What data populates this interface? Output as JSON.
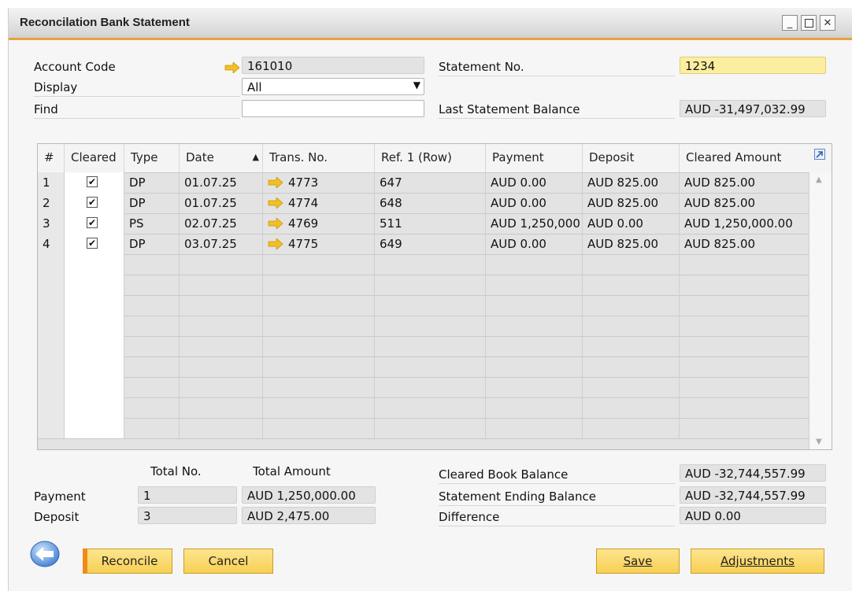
{
  "window": {
    "title": "Reconcilation Bank Statement"
  },
  "header": {
    "account_code_label": "Account Code",
    "account_code_value": "161010",
    "display_label": "Display",
    "display_value": "All",
    "find_label": "Find",
    "find_value": "",
    "statement_no_label": "Statement No.",
    "statement_no_value": "1234",
    "last_balance_label": "Last Statement Balance",
    "last_balance_value": "AUD -31,497,032.99"
  },
  "grid": {
    "columns": [
      "#",
      "Cleared",
      "Type",
      "Date",
      "Trans. No.",
      "Ref. 1 (Row)",
      "Payment",
      "Deposit",
      "Cleared Amount"
    ],
    "rows": [
      {
        "num": "1",
        "cleared": true,
        "type": "DP",
        "date": "01.07.25",
        "trans_no": "4773",
        "ref": "647",
        "payment": "AUD 0.00",
        "deposit": "AUD 825.00",
        "cleared_amount": "AUD 825.00"
      },
      {
        "num": "2",
        "cleared": true,
        "type": "DP",
        "date": "01.07.25",
        "trans_no": "4774",
        "ref": "648",
        "payment": "AUD 0.00",
        "deposit": "AUD 825.00",
        "cleared_amount": "AUD 825.00"
      },
      {
        "num": "3",
        "cleared": true,
        "type": "PS",
        "date": "02.07.25",
        "trans_no": "4769",
        "ref": "511",
        "payment": "AUD 1,250,000",
        "deposit": "AUD 0.00",
        "cleared_amount": "AUD 1,250,000.00"
      },
      {
        "num": "4",
        "cleared": true,
        "type": "DP",
        "date": "03.07.25",
        "trans_no": "4775",
        "ref": "649",
        "payment": "AUD 0.00",
        "deposit": "AUD 825.00",
        "cleared_amount": "AUD 825.00"
      }
    ]
  },
  "totals": {
    "total_no_label": "Total No.",
    "total_amount_label": "Total Amount",
    "payment_label": "Payment",
    "payment_count": "1",
    "payment_amount": "AUD 1,250,000.00",
    "deposit_label": "Deposit",
    "deposit_count": "3",
    "deposit_amount": "AUD 2,475.00",
    "cleared_book_label": "Cleared Book Balance",
    "cleared_book_value": "AUD -32,744,557.99",
    "ending_balance_label": "Statement Ending Balance",
    "ending_balance_value": "AUD -32,744,557.99",
    "difference_label": "Difference",
    "difference_value": "AUD 0.00"
  },
  "buttons": {
    "reconcile": "Reconcile",
    "cancel": "Cancel",
    "save": "Save",
    "adjustments": "Adjustments"
  },
  "colors": {
    "accent": "#e8a33a",
    "button": "#f7cf53",
    "link_arrow": "#f2c026",
    "statement_field": "#fbeea0"
  }
}
